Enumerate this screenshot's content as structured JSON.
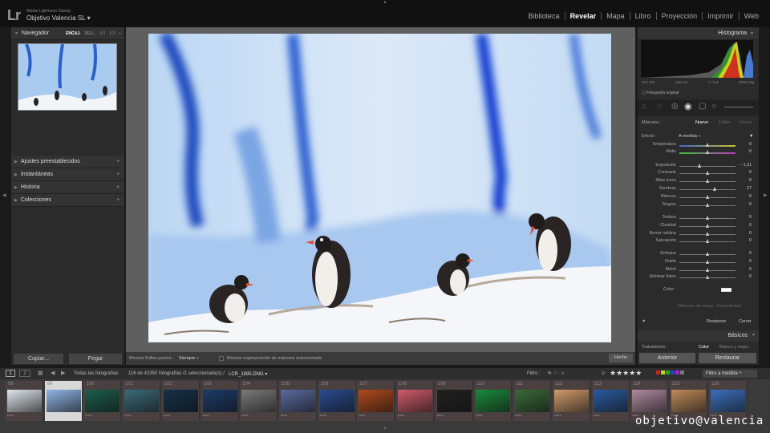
{
  "app": {
    "logo": "Lr",
    "subtitle": "Adobe Lightroom Classic",
    "catalog": "Objetivo Valencia SL",
    "catalog_caret": "▾"
  },
  "modules": [
    "Biblioteca",
    "Revelar",
    "Mapa",
    "Libro",
    "Proyección",
    "Imprimir",
    "Web"
  ],
  "active_module": "Revelar",
  "left": {
    "navigator": {
      "title": "Navegador",
      "options": [
        "ENCAJ.",
        "RELL.",
        "1:1",
        "1:2"
      ],
      "options_caret": "÷"
    },
    "panels": [
      {
        "label": "Ajustes preestablecidos",
        "action": "+"
      },
      {
        "label": "Instantáneas",
        "action": "+"
      },
      {
        "label": "Historia",
        "action": "×"
      },
      {
        "label": "Colecciones",
        "action": "+"
      }
    ],
    "copy_label": "Copiar...",
    "paste_label": "Pegar"
  },
  "right": {
    "histogram_title": "Histograma",
    "exif": [
      "ISO 400",
      "125 mm",
      "ƒ / 6,3",
      "1/800 seg"
    ],
    "original_label": "Fotografía original",
    "mask_label": "Máscara :",
    "mask_new": "Nuevo",
    "mask_edit": "Editar",
    "mask_brush": "Pincel",
    "effect_label": "Efecto :",
    "effect_value": "A medida ÷",
    "sliders": [
      {
        "label": "Temperatura",
        "value": "0",
        "pos": 0.5
      },
      {
        "label": "Matiz",
        "value": "0",
        "pos": 0.5
      },
      {
        "label": "Exposición",
        "value": "– 1,21",
        "pos": 0.35
      },
      {
        "label": "Contraste",
        "value": "0",
        "pos": 0.5
      },
      {
        "label": "Altas luces",
        "value": "0",
        "pos": 0.5
      },
      {
        "label": "Sombras",
        "value": "27",
        "pos": 0.63
      },
      {
        "label": "Blancos",
        "value": "0",
        "pos": 0.5
      },
      {
        "label": "Negros",
        "value": "0",
        "pos": 0.5
      },
      {
        "label": "Textura",
        "value": "0",
        "pos": 0.5
      },
      {
        "label": "Claridad",
        "value": "0",
        "pos": 0.5
      },
      {
        "label": "Borrar neblina",
        "value": "0",
        "pos": 0.5
      },
      {
        "label": "Saturación",
        "value": "0",
        "pos": 0.5
      },
      {
        "label": "Enfoque",
        "value": "0",
        "pos": 0.5
      },
      {
        "label": "Ruido",
        "value": "0",
        "pos": 0.5
      },
      {
        "label": "Moiré",
        "value": "0",
        "pos": 0.5
      },
      {
        "label": "Eliminar halos",
        "value": "0",
        "pos": 0.5
      }
    ],
    "color_label": "Color",
    "range_label": "Máscara de rango : Desactivado",
    "reset_label": "Restaurar",
    "close_label": "Cerrar",
    "basics_title": "Básicos",
    "treatment_label": "Tratamiento :",
    "treatment_color": "Color",
    "treatment_bw": "Blanco y negro",
    "prev_label": "Anterior",
    "restore_label": "Restaurar"
  },
  "toolbar": {
    "edit_points_label": "Mostrar Editar puntos :",
    "edit_points_value": "Siempre ÷",
    "overlay_label": "Mostrar superposición de máscara seleccionada",
    "done_label": "Hecho"
  },
  "filmbar": {
    "source": "Todas las fotografías",
    "count": "116 de 42350 fotografías /1 seleccionada(s) /",
    "filename": "LCR_1895.DNG ▾",
    "filter_label": "Filtro :",
    "filter_value": "Filtro a medida ÷",
    "stars": "★★★★★"
  },
  "film_colors": [
    "#dfe6ec",
    "#8fb6e6",
    "#1a5e4a",
    "#3a6a7a",
    "#14304a",
    "#1c3a68",
    "#7a7a7a",
    "#5a6aa0",
    "#2a4a90",
    "#b04a1a",
    "#d05a6a",
    "#202020",
    "#1a8a3a",
    "#3a6a3a",
    "#d09a6a",
    "#2a5aa0",
    "#b08aa0",
    "#c08a5a",
    "#3a70c0"
  ],
  "film_numbers": [
    "98",
    "99",
    "100",
    "101",
    "102",
    "103",
    "104",
    "105",
    "106",
    "107",
    "108",
    "109",
    "110",
    "111",
    "112",
    "113",
    "114",
    "115",
    "116"
  ],
  "watermark": "objetivo@valencia"
}
